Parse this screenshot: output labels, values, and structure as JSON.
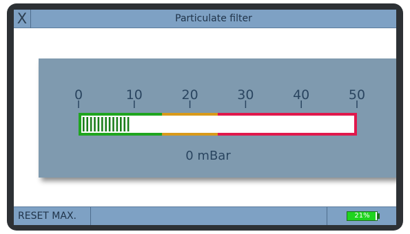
{
  "window": {
    "title": "Particulate filter",
    "close_label": "X"
  },
  "gauge": {
    "scale_labels": [
      "0",
      "10",
      "20",
      "30",
      "40",
      "50"
    ],
    "min": 0,
    "max": 50,
    "zones": [
      {
        "from": 0,
        "to": 15,
        "color": "#1fa51f"
      },
      {
        "from": 15,
        "to": 25,
        "color": "#d99a1a"
      },
      {
        "from": 25,
        "to": 50,
        "color": "#e0184c"
      }
    ],
    "value_text": "0 mBar",
    "peak_fill_fraction": 0.17
  },
  "status": {
    "reset_label": "RESET MAX.",
    "battery_text": "21%",
    "battery_level": 0.95,
    "battery_color": "#1fd41f"
  },
  "colors": {
    "bar_accent": "#7ea1c4",
    "panel": "#7f9aaf",
    "scale_text": "#2a4560"
  }
}
